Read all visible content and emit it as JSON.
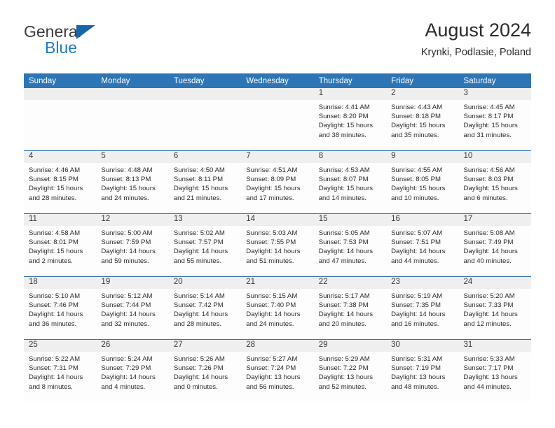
{
  "brand": {
    "name_line1": "General",
    "name_line2": "Blue",
    "accent_color": "#1f7ac4",
    "triangle_color": "#1766ab"
  },
  "header": {
    "month_title": "August 2024",
    "location": "Krynki, Podlasie, Poland",
    "header_band_color": "#2e75b6",
    "daynum_band_color": "#efefef"
  },
  "weekday_headers": [
    "Sunday",
    "Monday",
    "Tuesday",
    "Wednesday",
    "Thursday",
    "Friday",
    "Saturday"
  ],
  "labels": {
    "sunrise_prefix": "Sunrise:",
    "sunset_prefix": "Sunset:",
    "daylight_prefix": "Daylight:"
  },
  "weeks": [
    [
      {
        "day": "",
        "sunrise": "",
        "sunset": "",
        "daylight": "",
        "empty": true
      },
      {
        "day": "",
        "sunrise": "",
        "sunset": "",
        "daylight": "",
        "empty": true
      },
      {
        "day": "",
        "sunrise": "",
        "sunset": "",
        "daylight": "",
        "empty": true
      },
      {
        "day": "",
        "sunrise": "",
        "sunset": "",
        "daylight": "",
        "empty": true
      },
      {
        "day": "1",
        "sunrise": "Sunrise: 4:41 AM",
        "sunset": "Sunset: 8:20 PM",
        "daylight": "Daylight: 15 hours and 38 minutes.",
        "empty": false
      },
      {
        "day": "2",
        "sunrise": "Sunrise: 4:43 AM",
        "sunset": "Sunset: 8:18 PM",
        "daylight": "Daylight: 15 hours and 35 minutes.",
        "empty": false
      },
      {
        "day": "3",
        "sunrise": "Sunrise: 4:45 AM",
        "sunset": "Sunset: 8:17 PM",
        "daylight": "Daylight: 15 hours and 31 minutes.",
        "empty": false
      }
    ],
    [
      {
        "day": "4",
        "sunrise": "Sunrise: 4:46 AM",
        "sunset": "Sunset: 8:15 PM",
        "daylight": "Daylight: 15 hours and 28 minutes.",
        "empty": false
      },
      {
        "day": "5",
        "sunrise": "Sunrise: 4:48 AM",
        "sunset": "Sunset: 8:13 PM",
        "daylight": "Daylight: 15 hours and 24 minutes.",
        "empty": false
      },
      {
        "day": "6",
        "sunrise": "Sunrise: 4:50 AM",
        "sunset": "Sunset: 8:11 PM",
        "daylight": "Daylight: 15 hours and 21 minutes.",
        "empty": false
      },
      {
        "day": "7",
        "sunrise": "Sunrise: 4:51 AM",
        "sunset": "Sunset: 8:09 PM",
        "daylight": "Daylight: 15 hours and 17 minutes.",
        "empty": false
      },
      {
        "day": "8",
        "sunrise": "Sunrise: 4:53 AM",
        "sunset": "Sunset: 8:07 PM",
        "daylight": "Daylight: 15 hours and 14 minutes.",
        "empty": false
      },
      {
        "day": "9",
        "sunrise": "Sunrise: 4:55 AM",
        "sunset": "Sunset: 8:05 PM",
        "daylight": "Daylight: 15 hours and 10 minutes.",
        "empty": false
      },
      {
        "day": "10",
        "sunrise": "Sunrise: 4:56 AM",
        "sunset": "Sunset: 8:03 PM",
        "daylight": "Daylight: 15 hours and 6 minutes.",
        "empty": false
      }
    ],
    [
      {
        "day": "11",
        "sunrise": "Sunrise: 4:58 AM",
        "sunset": "Sunset: 8:01 PM",
        "daylight": "Daylight: 15 hours and 2 minutes.",
        "empty": false
      },
      {
        "day": "12",
        "sunrise": "Sunrise: 5:00 AM",
        "sunset": "Sunset: 7:59 PM",
        "daylight": "Daylight: 14 hours and 59 minutes.",
        "empty": false
      },
      {
        "day": "13",
        "sunrise": "Sunrise: 5:02 AM",
        "sunset": "Sunset: 7:57 PM",
        "daylight": "Daylight: 14 hours and 55 minutes.",
        "empty": false
      },
      {
        "day": "14",
        "sunrise": "Sunrise: 5:03 AM",
        "sunset": "Sunset: 7:55 PM",
        "daylight": "Daylight: 14 hours and 51 minutes.",
        "empty": false
      },
      {
        "day": "15",
        "sunrise": "Sunrise: 5:05 AM",
        "sunset": "Sunset: 7:53 PM",
        "daylight": "Daylight: 14 hours and 47 minutes.",
        "empty": false
      },
      {
        "day": "16",
        "sunrise": "Sunrise: 5:07 AM",
        "sunset": "Sunset: 7:51 PM",
        "daylight": "Daylight: 14 hours and 44 minutes.",
        "empty": false
      },
      {
        "day": "17",
        "sunrise": "Sunrise: 5:08 AM",
        "sunset": "Sunset: 7:49 PM",
        "daylight": "Daylight: 14 hours and 40 minutes.",
        "empty": false
      }
    ],
    [
      {
        "day": "18",
        "sunrise": "Sunrise: 5:10 AM",
        "sunset": "Sunset: 7:46 PM",
        "daylight": "Daylight: 14 hours and 36 minutes.",
        "empty": false
      },
      {
        "day": "19",
        "sunrise": "Sunrise: 5:12 AM",
        "sunset": "Sunset: 7:44 PM",
        "daylight": "Daylight: 14 hours and 32 minutes.",
        "empty": false
      },
      {
        "day": "20",
        "sunrise": "Sunrise: 5:14 AM",
        "sunset": "Sunset: 7:42 PM",
        "daylight": "Daylight: 14 hours and 28 minutes.",
        "empty": false
      },
      {
        "day": "21",
        "sunrise": "Sunrise: 5:15 AM",
        "sunset": "Sunset: 7:40 PM",
        "daylight": "Daylight: 14 hours and 24 minutes.",
        "empty": false
      },
      {
        "day": "22",
        "sunrise": "Sunrise: 5:17 AM",
        "sunset": "Sunset: 7:38 PM",
        "daylight": "Daylight: 14 hours and 20 minutes.",
        "empty": false
      },
      {
        "day": "23",
        "sunrise": "Sunrise: 5:19 AM",
        "sunset": "Sunset: 7:35 PM",
        "daylight": "Daylight: 14 hours and 16 minutes.",
        "empty": false
      },
      {
        "day": "24",
        "sunrise": "Sunrise: 5:20 AM",
        "sunset": "Sunset: 7:33 PM",
        "daylight": "Daylight: 14 hours and 12 minutes.",
        "empty": false
      }
    ],
    [
      {
        "day": "25",
        "sunrise": "Sunrise: 5:22 AM",
        "sunset": "Sunset: 7:31 PM",
        "daylight": "Daylight: 14 hours and 8 minutes.",
        "empty": false
      },
      {
        "day": "26",
        "sunrise": "Sunrise: 5:24 AM",
        "sunset": "Sunset: 7:29 PM",
        "daylight": "Daylight: 14 hours and 4 minutes.",
        "empty": false
      },
      {
        "day": "27",
        "sunrise": "Sunrise: 5:26 AM",
        "sunset": "Sunset: 7:26 PM",
        "daylight": "Daylight: 14 hours and 0 minutes.",
        "empty": false
      },
      {
        "day": "28",
        "sunrise": "Sunrise: 5:27 AM",
        "sunset": "Sunset: 7:24 PM",
        "daylight": "Daylight: 13 hours and 56 minutes.",
        "empty": false
      },
      {
        "day": "29",
        "sunrise": "Sunrise: 5:29 AM",
        "sunset": "Sunset: 7:22 PM",
        "daylight": "Daylight: 13 hours and 52 minutes.",
        "empty": false
      },
      {
        "day": "30",
        "sunrise": "Sunrise: 5:31 AM",
        "sunset": "Sunset: 7:19 PM",
        "daylight": "Daylight: 13 hours and 48 minutes.",
        "empty": false
      },
      {
        "day": "31",
        "sunrise": "Sunrise: 5:33 AM",
        "sunset": "Sunset: 7:17 PM",
        "daylight": "Daylight: 13 hours and 44 minutes.",
        "empty": false
      }
    ]
  ]
}
